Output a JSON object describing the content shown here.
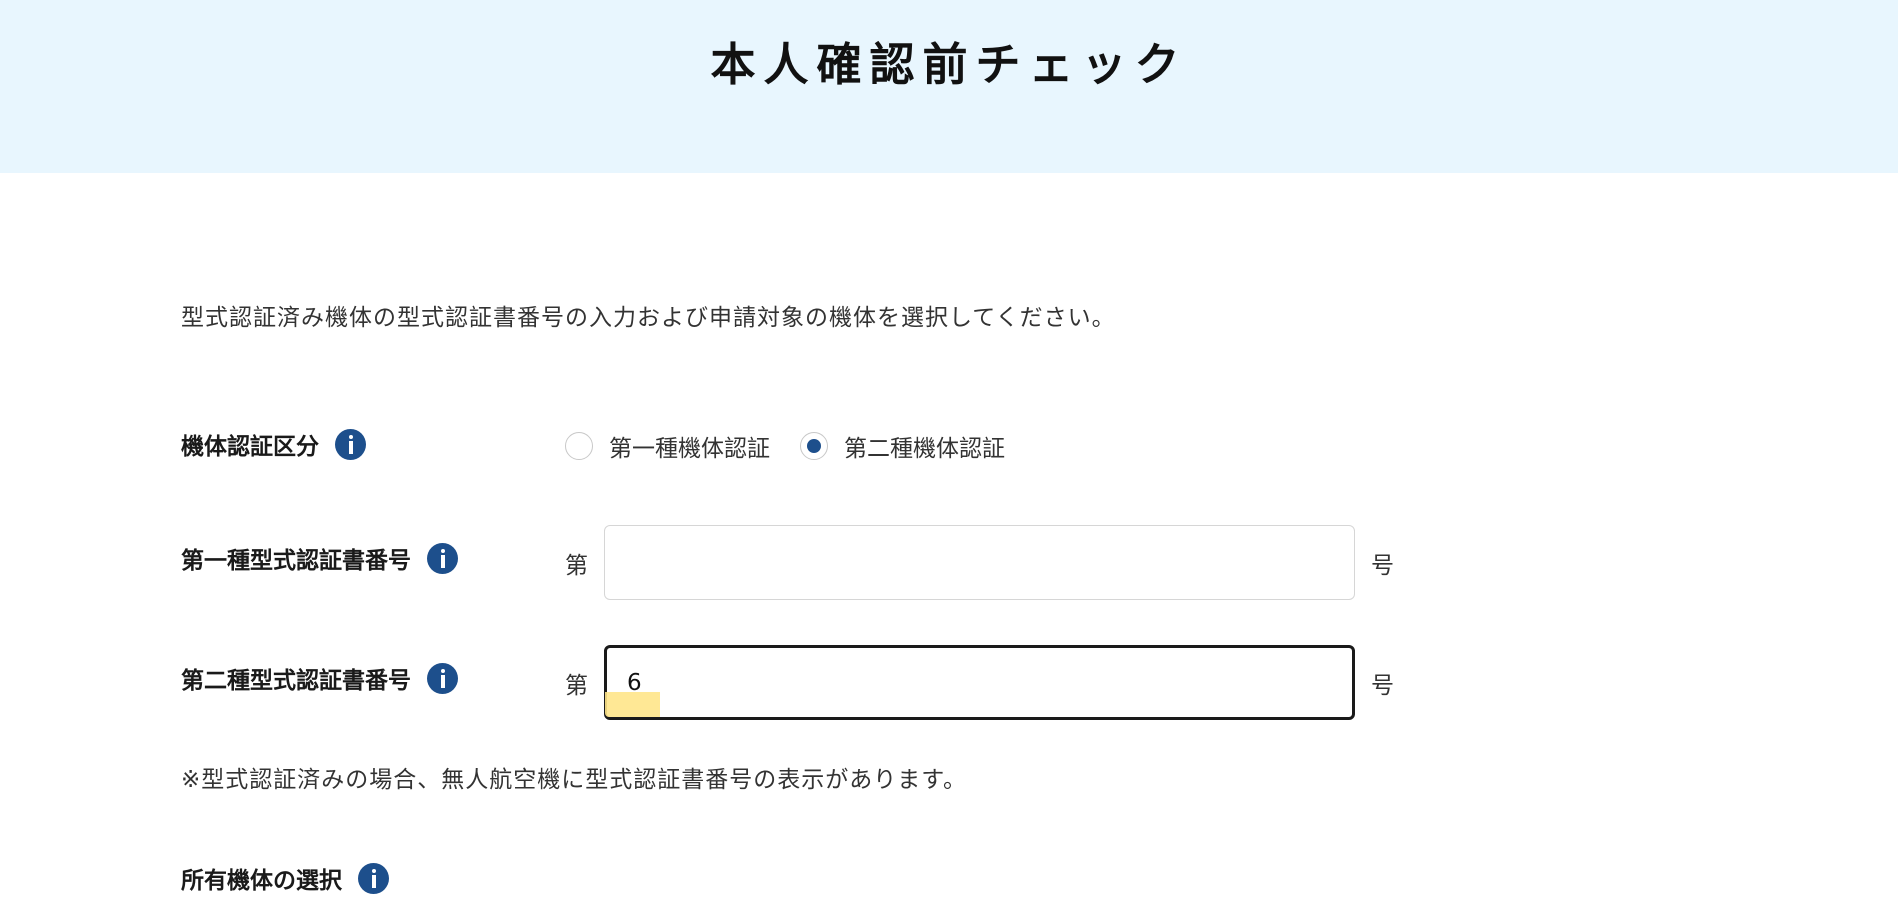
{
  "header": {
    "title": "本人確認前チェック"
  },
  "intro_text": "型式認証済み機体の型式認証書番号の入力および申請対象の機体を選択してください。",
  "classification": {
    "label": "機体認証区分",
    "options": [
      {
        "label": "第一種機体認証",
        "checked": false
      },
      {
        "label": "第二種機体認証",
        "checked": true
      }
    ]
  },
  "first_class_cert": {
    "label": "第一種型式認証書番号",
    "prefix": "第",
    "suffix": "号",
    "value": ""
  },
  "second_class_cert": {
    "label": "第二種型式認証書番号",
    "prefix": "第",
    "suffix": "号",
    "value": "6"
  },
  "note_text": "※型式認証済みの場合、無人航空機に型式認証書番号の表示があります。",
  "owned_aircraft": {
    "label": "所有機体の選択"
  },
  "colors": {
    "header_bg": "#e8f6fe",
    "accent": "#1d4f8c",
    "highlight": "#ffe58a"
  }
}
